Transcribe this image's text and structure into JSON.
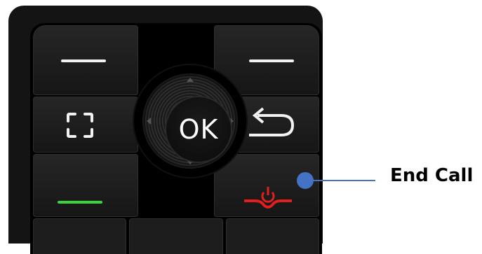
{
  "keypad": {
    "ok_label": "OK",
    "icons": {
      "left_softkey": "softkey-line-icon",
      "right_softkey": "softkey-line-icon",
      "frame": "frame-icon",
      "back": "back-arrow-icon",
      "call": "call-green-line-icon",
      "end_call": "end-call-power-icon"
    },
    "colors": {
      "body": "#141414",
      "call_green": "#39d437",
      "end_red": "#e01f1f",
      "callout_blue": "#4472c4"
    }
  },
  "callout": {
    "label": "End Call"
  }
}
